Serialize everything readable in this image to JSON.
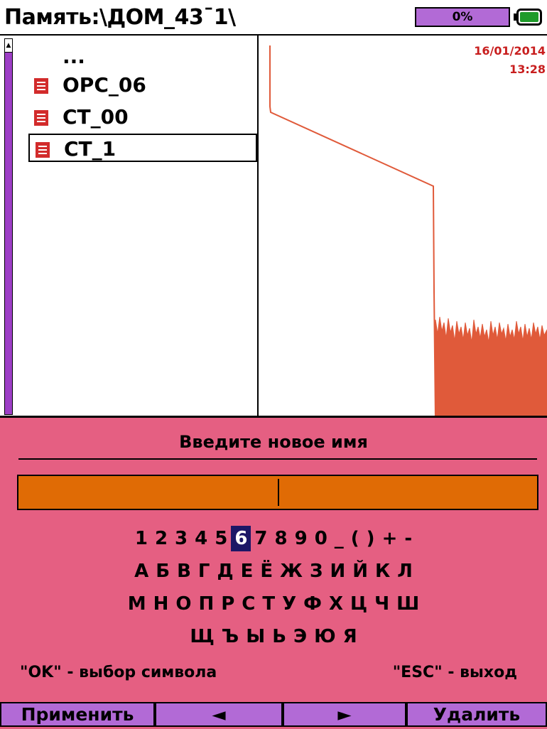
{
  "header": {
    "title": "Память:\\ДОМ_43ˉ1\\",
    "progress_label": "0%",
    "progress_value": 0,
    "battery_icon": "battery-icon",
    "colors": {
      "progress": "#b26ad6",
      "battery": "#1e9a2a"
    }
  },
  "file_list": {
    "items": [
      {
        "label": "...",
        "icon": "none",
        "selected": false
      },
      {
        "label": "OPC_06",
        "icon": "document-icon",
        "selected": false
      },
      {
        "label": "CT_00",
        "icon": "document-icon",
        "selected": false
      },
      {
        "label": "CT_1",
        "icon": "document-icon",
        "selected": true
      }
    ]
  },
  "trace": {
    "date": "16/01/2014",
    "time": "13:28",
    "color": "#e05a3a"
  },
  "dialog": {
    "title": "Введите новое имя",
    "input_value": "",
    "rows": [
      [
        "1",
        "2",
        "3",
        "4",
        "5",
        "6",
        "7",
        "8",
        "9",
        "0",
        "_",
        "(",
        ")",
        "+",
        "-"
      ],
      [
        "А",
        "Б",
        "В",
        "Г",
        "Д",
        "Е",
        "Ё",
        "Ж",
        "З",
        "И",
        "Й",
        "К",
        "Л"
      ],
      [
        "М",
        "Н",
        "О",
        "П",
        "Р",
        "С",
        "Т",
        "У",
        "Ф",
        "Х",
        "Ц",
        "Ч",
        "Ш"
      ],
      [
        "Щ",
        "Ъ",
        "Ы",
        "Ь",
        "Э",
        "Ю",
        "Я"
      ]
    ],
    "selected_key": "6",
    "hint_ok": "\"OK\" - выбор символа",
    "hint_esc": "\"ESC\" - выход",
    "colors": {
      "background": "#e55f82",
      "input": "#e06b05",
      "selected_key": "#1c1766"
    }
  },
  "softkeys": {
    "apply": "Применить",
    "left": "◄",
    "right": "►",
    "delete": "Удалить"
  }
}
